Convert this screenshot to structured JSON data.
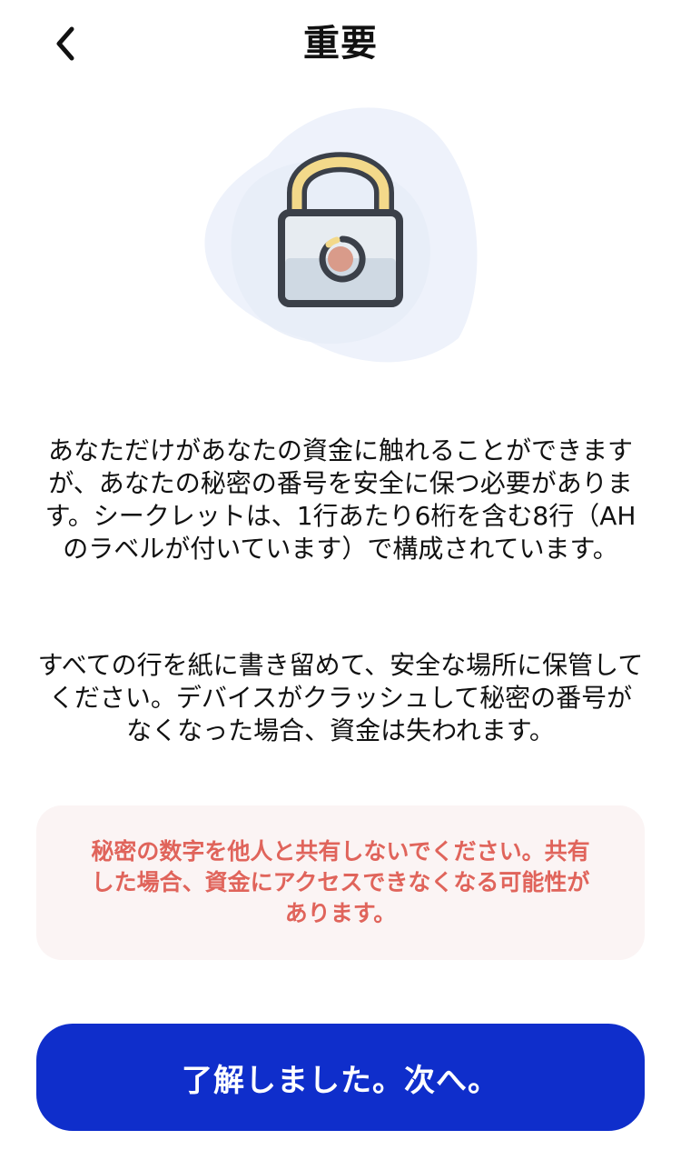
{
  "header": {
    "title": "重要",
    "back_icon": "chevron-left-icon"
  },
  "illustration": {
    "icon": "padlock-icon",
    "colors": {
      "blob": "#eef2fb",
      "shackle": "#f3d98a",
      "outline": "#3b4049",
      "body_top": "#e7ecf1",
      "body_bottom": "#cfd9e3",
      "keyhole": "#d99b8a"
    }
  },
  "content": {
    "paragraph_1": "あなただけがあなたの資金に触れることができますが、あなたの秘密の番号を安全に保つ必要があります。シークレットは、1行あたり6桁を含む8行（AHのラベルが付いています）で構成されています。",
    "paragraph_2": "すべての行を紙に書き留めて、安全な場所に保管してください。デバイスがクラッシュして秘密の番号がなくなった場合、資金は失われます。"
  },
  "warning": {
    "text": "秘密の数字を他人と共有しないでください。共有した場合、資金にアクセスできなくなる可能性があります。",
    "text_color": "#e0645b",
    "background": "#fbf4f4"
  },
  "actions": {
    "primary_label": "了解しました。次へ。",
    "primary_color": "#0f2ecb"
  }
}
